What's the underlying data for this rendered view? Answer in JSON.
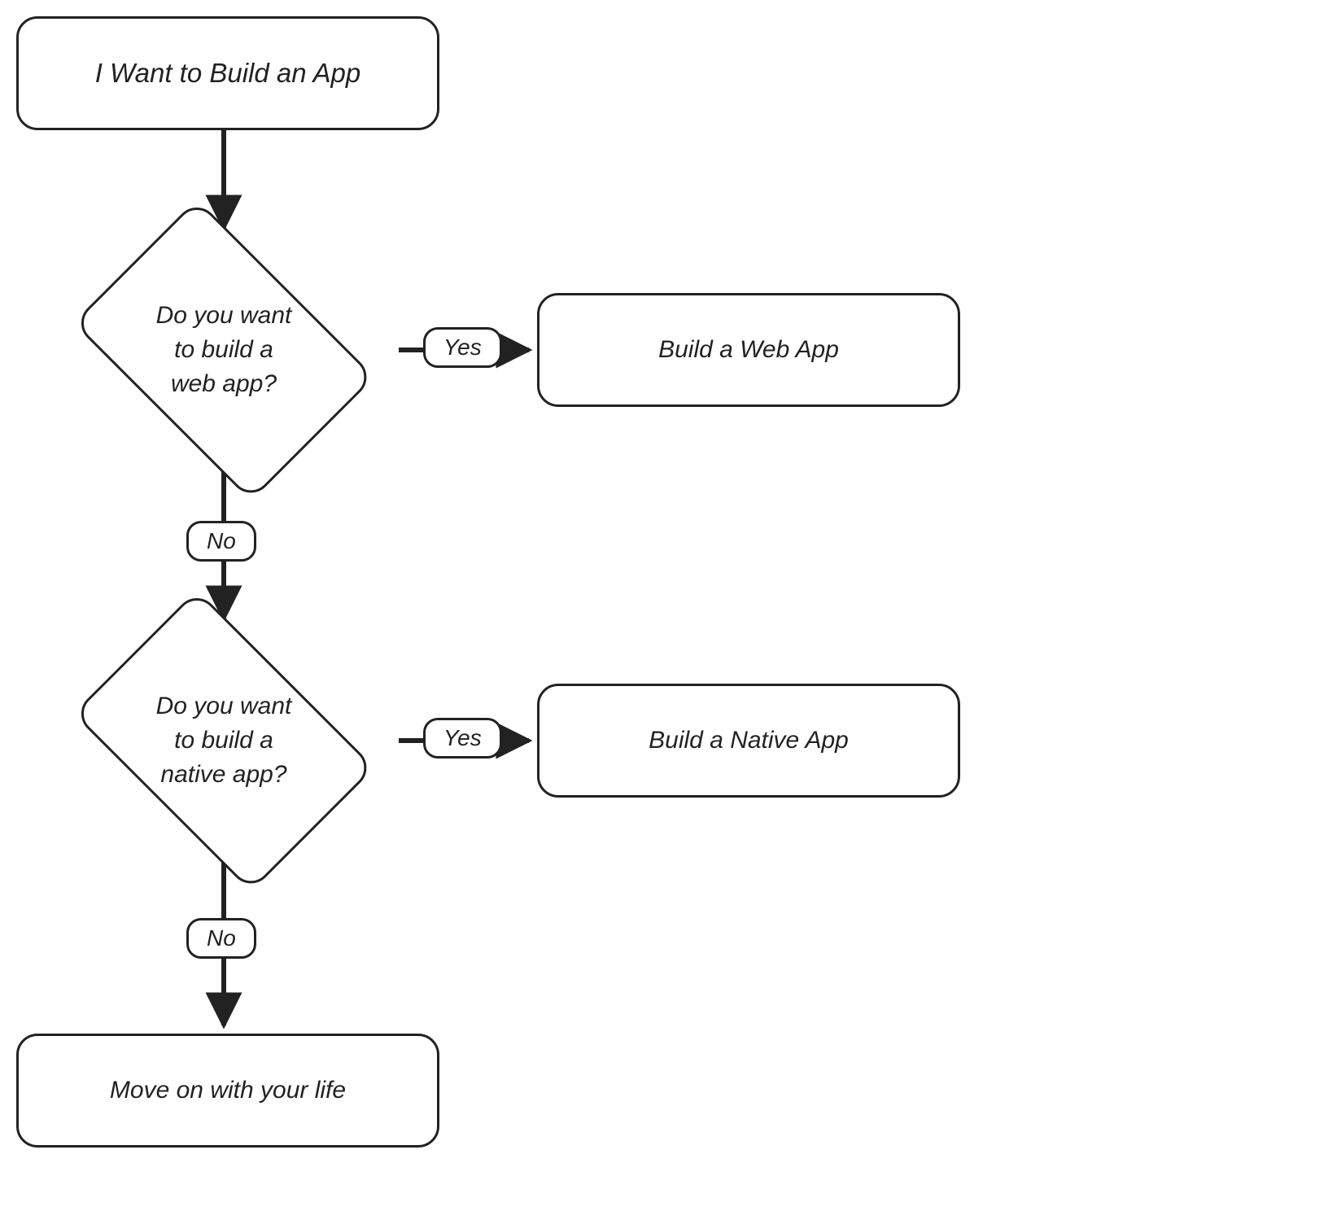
{
  "nodes": {
    "start": {
      "text": "I Want to Build an App"
    },
    "decision_web": {
      "text": "Do you want\nto build a\nweb app?"
    },
    "build_web": {
      "text": "Build a Web App"
    },
    "decision_native": {
      "text": "Do you want\nto build a\nnative app?"
    },
    "build_native": {
      "text": "Build a Native App"
    },
    "move_on": {
      "text": "Move on with your life"
    }
  },
  "edges": {
    "yes1": "Yes",
    "no1": "No",
    "yes2": "Yes",
    "no2": "No"
  },
  "colors": {
    "stroke": "#222222",
    "bg": "#ffffff"
  }
}
